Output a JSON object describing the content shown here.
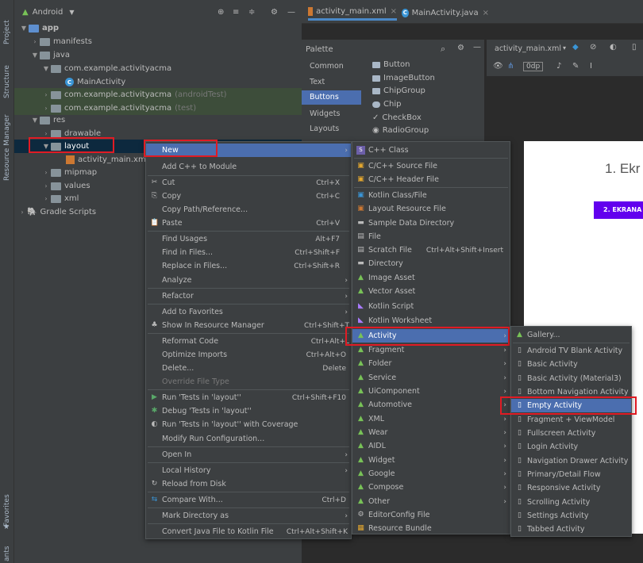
{
  "side_strip": {
    "project": "Project",
    "structure": "Structure",
    "resource_manager": "Resource Manager",
    "favorites": "Favorites",
    "ants": "ants"
  },
  "project_header": {
    "title": "Android"
  },
  "tree": [
    {
      "label": "app",
      "note": ""
    },
    {
      "label": "manifests",
      "note": ""
    },
    {
      "label": "java",
      "note": ""
    },
    {
      "label": "com.example.activityacma",
      "note": ""
    },
    {
      "label": "MainActivity",
      "note": ""
    },
    {
      "label": "com.example.activityacma",
      "note": "(androidTest)"
    },
    {
      "label": "com.example.activityacma",
      "note": "(test)"
    },
    {
      "label": "res",
      "note": ""
    },
    {
      "label": "drawable",
      "note": ""
    },
    {
      "label": "layout",
      "note": ""
    },
    {
      "label": "activity_main.xml",
      "note": ""
    },
    {
      "label": "mipmap",
      "note": ""
    },
    {
      "label": "values",
      "note": ""
    },
    {
      "label": "xml",
      "note": ""
    },
    {
      "label": "Gradle Scripts",
      "note": ""
    }
  ],
  "tabs": [
    {
      "label": "activity_main.xml"
    },
    {
      "label": "MainActivity.java"
    }
  ],
  "palette": {
    "title": "Palette",
    "categories": [
      "Common",
      "Text",
      "Buttons",
      "Widgets",
      "Layouts"
    ],
    "items": [
      "Button",
      "ImageButton",
      "ChipGroup",
      "Chip",
      "CheckBox",
      "RadioGroup"
    ],
    "file_label": "activity_main.xml",
    "dp_value": "0dp"
  },
  "design": {
    "title": "1. Ekr",
    "button": "2. EKRANA"
  },
  "context_menu": [
    {
      "label": "New",
      "shortcut": "",
      "arrow": true
    },
    {
      "label": "Add C++ to Module",
      "shortcut": ""
    },
    {
      "label": "Cut",
      "shortcut": "Ctrl+X"
    },
    {
      "label": "Copy",
      "shortcut": "Ctrl+C"
    },
    {
      "label": "Copy Path/Reference...",
      "shortcut": ""
    },
    {
      "label": "Paste",
      "shortcut": "Ctrl+V"
    },
    {
      "label": "Find Usages",
      "shortcut": "Alt+F7"
    },
    {
      "label": "Find in Files...",
      "shortcut": "Ctrl+Shift+F"
    },
    {
      "label": "Replace in Files...",
      "shortcut": "Ctrl+Shift+R"
    },
    {
      "label": "Analyze",
      "shortcut": "",
      "arrow": true
    },
    {
      "label": "Refactor",
      "shortcut": "",
      "arrow": true
    },
    {
      "label": "Add to Favorites",
      "shortcut": "",
      "arrow": true
    },
    {
      "label": "Show In Resource Manager",
      "shortcut": "Ctrl+Shift+T"
    },
    {
      "label": "Reformat Code",
      "shortcut": "Ctrl+Alt+L"
    },
    {
      "label": "Optimize Imports",
      "shortcut": "Ctrl+Alt+O"
    },
    {
      "label": "Delete...",
      "shortcut": "Delete"
    },
    {
      "label": "Override File Type",
      "shortcut": ""
    },
    {
      "label": "Run 'Tests in 'layout''",
      "shortcut": "Ctrl+Shift+F10"
    },
    {
      "label": "Debug 'Tests in 'layout''",
      "shortcut": ""
    },
    {
      "label": "Run 'Tests in 'layout'' with Coverage",
      "shortcut": ""
    },
    {
      "label": "Modify Run Configuration...",
      "shortcut": ""
    },
    {
      "label": "Open In",
      "shortcut": "",
      "arrow": true
    },
    {
      "label": "Local History",
      "shortcut": "",
      "arrow": true
    },
    {
      "label": "Reload from Disk",
      "shortcut": ""
    },
    {
      "label": "Compare With...",
      "shortcut": "Ctrl+D"
    },
    {
      "label": "Mark Directory as",
      "shortcut": "",
      "arrow": true
    },
    {
      "label": "Convert Java File to Kotlin File",
      "shortcut": "Ctrl+Alt+Shift+K"
    }
  ],
  "new_menu": [
    {
      "label": "C++ Class",
      "shortcut": ""
    },
    {
      "label": "C/C++ Source File",
      "shortcut": ""
    },
    {
      "label": "C/C++ Header File",
      "shortcut": ""
    },
    {
      "label": "Kotlin Class/File",
      "shortcut": ""
    },
    {
      "label": "Layout Resource File",
      "shortcut": ""
    },
    {
      "label": "Sample Data Directory",
      "shortcut": ""
    },
    {
      "label": "File",
      "shortcut": ""
    },
    {
      "label": "Scratch File",
      "shortcut": "Ctrl+Alt+Shift+Insert"
    },
    {
      "label": "Directory",
      "shortcut": ""
    },
    {
      "label": "Image Asset",
      "shortcut": ""
    },
    {
      "label": "Vector Asset",
      "shortcut": ""
    },
    {
      "label": "Kotlin Script",
      "shortcut": ""
    },
    {
      "label": "Kotlin Worksheet",
      "shortcut": ""
    },
    {
      "label": "Activity",
      "shortcut": ""
    },
    {
      "label": "Fragment",
      "shortcut": ""
    },
    {
      "label": "Folder",
      "shortcut": ""
    },
    {
      "label": "Service",
      "shortcut": ""
    },
    {
      "label": "UiComponent",
      "shortcut": ""
    },
    {
      "label": "Automotive",
      "shortcut": ""
    },
    {
      "label": "XML",
      "shortcut": ""
    },
    {
      "label": "Wear",
      "shortcut": ""
    },
    {
      "label": "AIDL",
      "shortcut": ""
    },
    {
      "label": "Widget",
      "shortcut": ""
    },
    {
      "label": "Google",
      "shortcut": ""
    },
    {
      "label": "Compose",
      "shortcut": ""
    },
    {
      "label": "Other",
      "shortcut": ""
    },
    {
      "label": "EditorConfig File",
      "shortcut": ""
    },
    {
      "label": "Resource Bundle",
      "shortcut": ""
    }
  ],
  "activity_menu": [
    "Gallery...",
    "Android TV Blank Activity",
    "Basic Activity",
    "Basic Activity (Material3)",
    "Bottom Navigation Activity",
    "Empty Activity",
    "Fragment + ViewModel",
    "Fullscreen Activity",
    "Login Activity",
    "Navigation Drawer Activity",
    "Primary/Detail Flow",
    "Responsive Activity",
    "Scrolling Activity",
    "Settings Activity",
    "Tabbed Activity"
  ]
}
